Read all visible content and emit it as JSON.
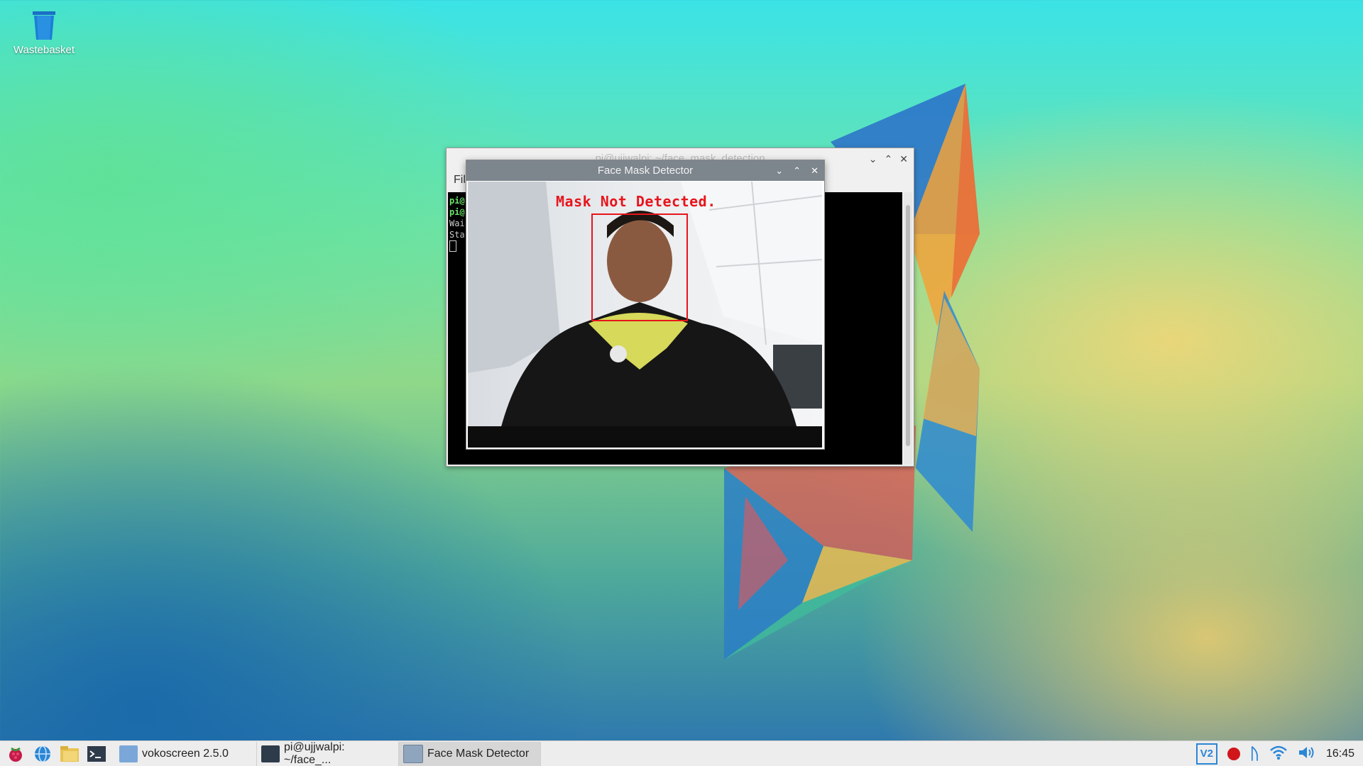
{
  "desktop": {
    "icons": [
      {
        "label": "Wastebasket",
        "icon": "trash-icon"
      }
    ]
  },
  "terminal_window": {
    "title": "pi@ujjwalpi: ~/face_mask_detection",
    "menu_label": "Fil",
    "lines": [
      "pi@",
      "pi@",
      "Wai",
      "Sta"
    ]
  },
  "detector_window": {
    "title": "Face Mask Detector",
    "status_text": "Mask Not Detected.",
    "status_color": "#e8141c"
  },
  "taskbar": {
    "launchers": [
      "raspberry-menu-icon",
      "web-browser-icon",
      "file-manager-icon",
      "terminal-icon"
    ],
    "tasks": [
      {
        "label": "vokoscreen 2.5.0",
        "icon": "vokoscreen-icon"
      },
      {
        "label": "pi@ujjwalpi: ~/face_...",
        "icon": "terminal-icon"
      },
      {
        "label": "Face Mask Detector",
        "icon": "window-icon"
      }
    ],
    "tray": [
      "vnc-icon",
      "record-icon",
      "bluetooth-icon",
      "wifi-icon",
      "volume-icon"
    ],
    "clock": "16:45"
  }
}
